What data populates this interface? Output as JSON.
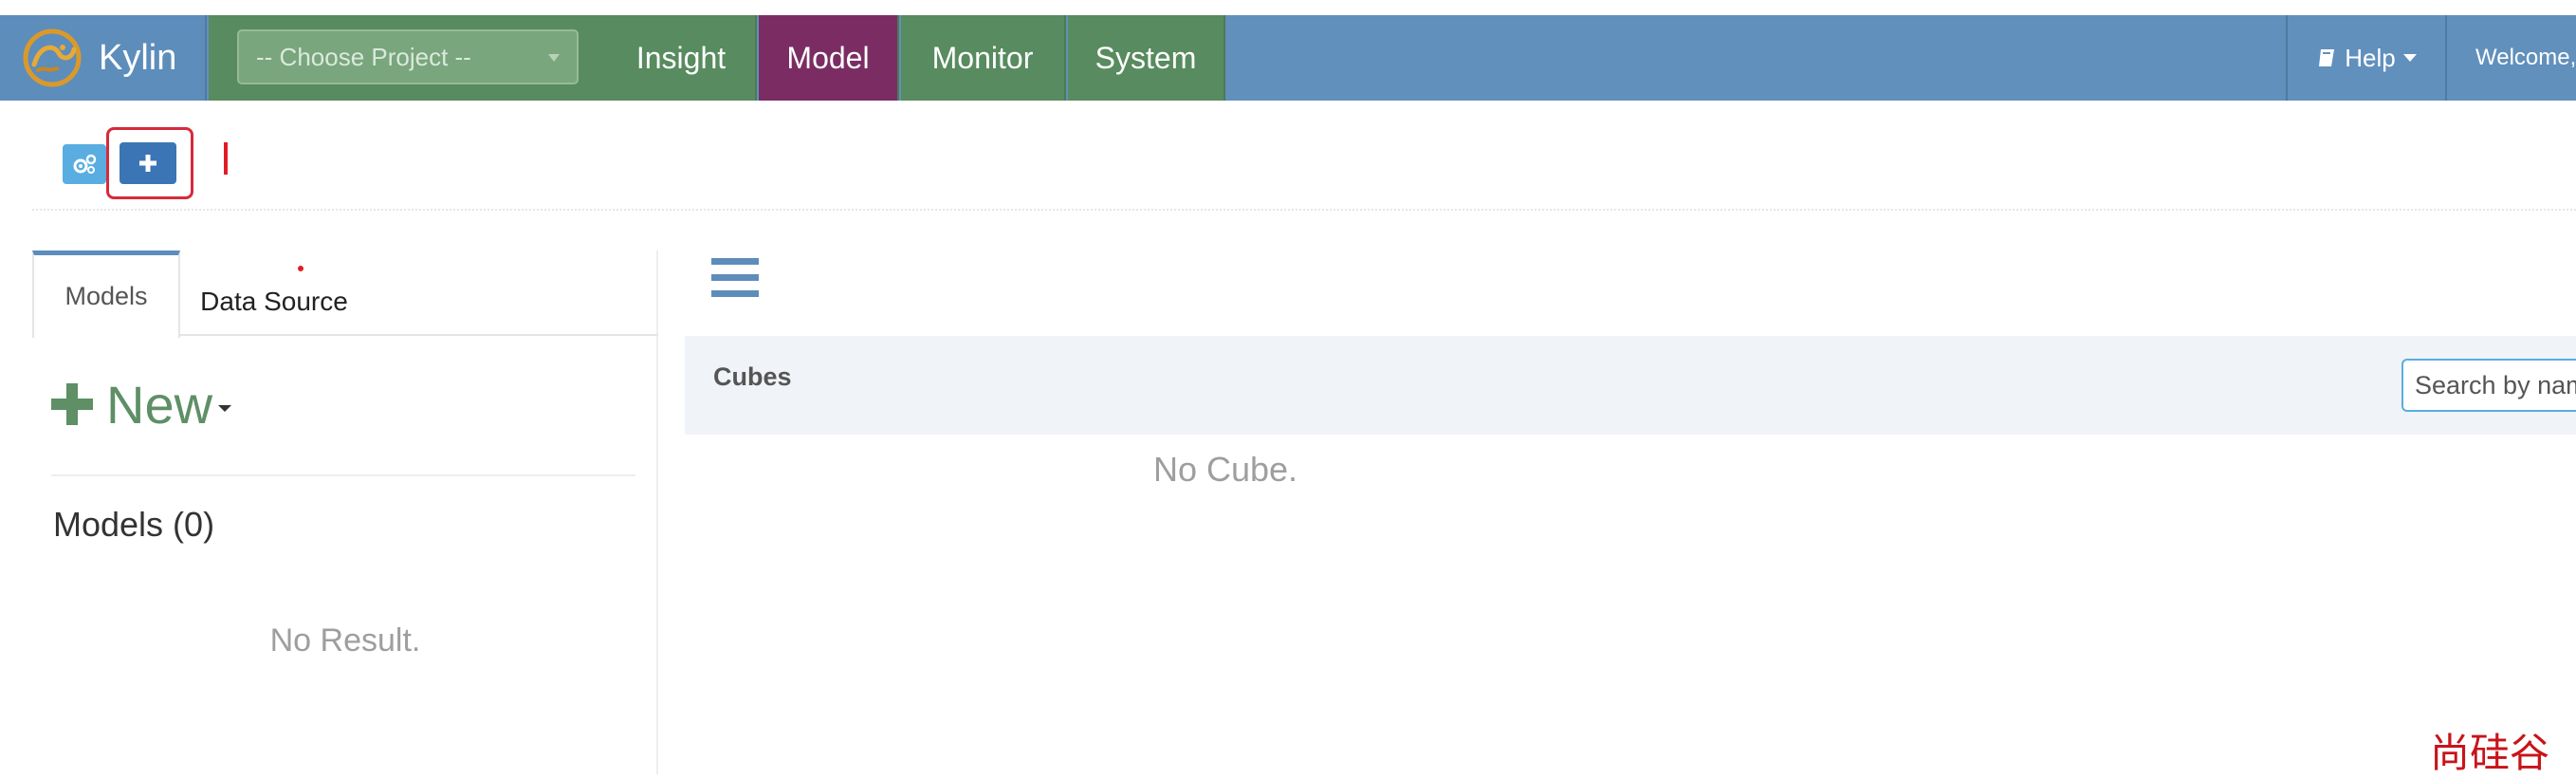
{
  "app": {
    "name": "Kylin"
  },
  "navbar": {
    "project_select": {
      "placeholder": "-- Choose Project --"
    },
    "tabs": [
      {
        "label": "Insight",
        "active": false
      },
      {
        "label": "Model",
        "active": true
      },
      {
        "label": "Monitor",
        "active": false
      },
      {
        "label": "System",
        "active": false
      }
    ],
    "help_label": "Help",
    "welcome_label": "Welcome,"
  },
  "toolbar": {
    "settings_icon": "gears-icon",
    "add_icon": "plus-icon"
  },
  "left_panel": {
    "tabs": [
      {
        "label": "Models",
        "active": true
      },
      {
        "label": "Data Source",
        "active": false
      }
    ],
    "new_button_label": "New",
    "models_heading": "Models (0)",
    "empty_text": "No Result."
  },
  "right_panel": {
    "menu_icon": "hamburger-icon",
    "cubes_title": "Cubes",
    "search_placeholder": "Search by name",
    "empty_text": "No Cube."
  },
  "watermark": {
    "text": "尚硅谷"
  },
  "colors": {
    "navbar": "#6190bc",
    "nav_tab": "#588b5f",
    "nav_tab_active": "#7b2d63",
    "highlight": "#d62b3b",
    "new_button": "#5e8f65",
    "watermark": "#c7141a"
  }
}
